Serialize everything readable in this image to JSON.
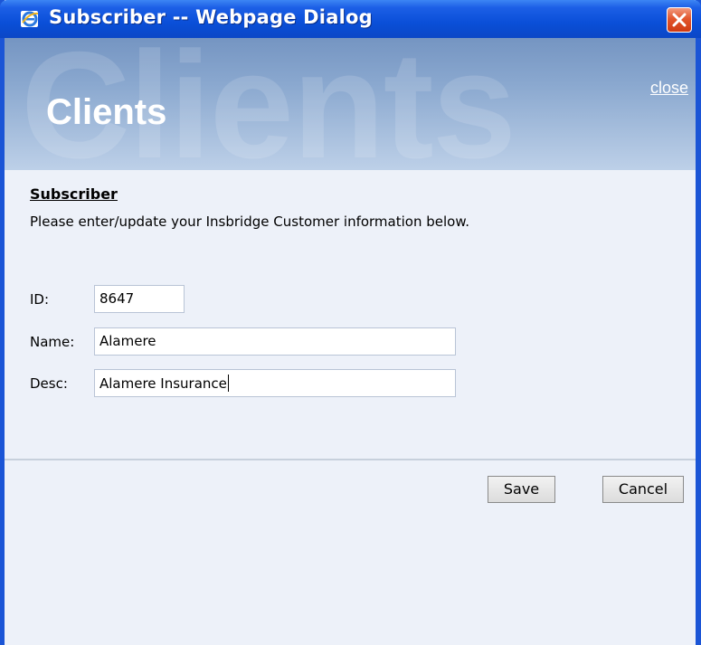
{
  "window": {
    "title": "Subscriber -- Webpage Dialog"
  },
  "banner": {
    "watermark_text": "Clients",
    "heading": "Clients",
    "close_link": "close"
  },
  "form": {
    "section_title": "Subscriber",
    "instructions": "Please enter/update your Insbridge Customer information below.",
    "fields": [
      {
        "label": "ID:",
        "value": "8647"
      },
      {
        "label": "Name:",
        "value": "Alamere"
      },
      {
        "label": "Desc:",
        "value": "Alamere Insurance"
      }
    ]
  },
  "buttons": {
    "save_label": "Save",
    "cancel_label": "Cancel"
  },
  "colors": {
    "title_bar": "#0a4fd8",
    "window_border": "#1b55d6",
    "content_background": "#edf1f9",
    "banner": "#8aa8cf",
    "close_button": "#e2562c"
  },
  "icons": {
    "window_icon": "internet-explorer-icon",
    "close": "close-x-icon"
  }
}
